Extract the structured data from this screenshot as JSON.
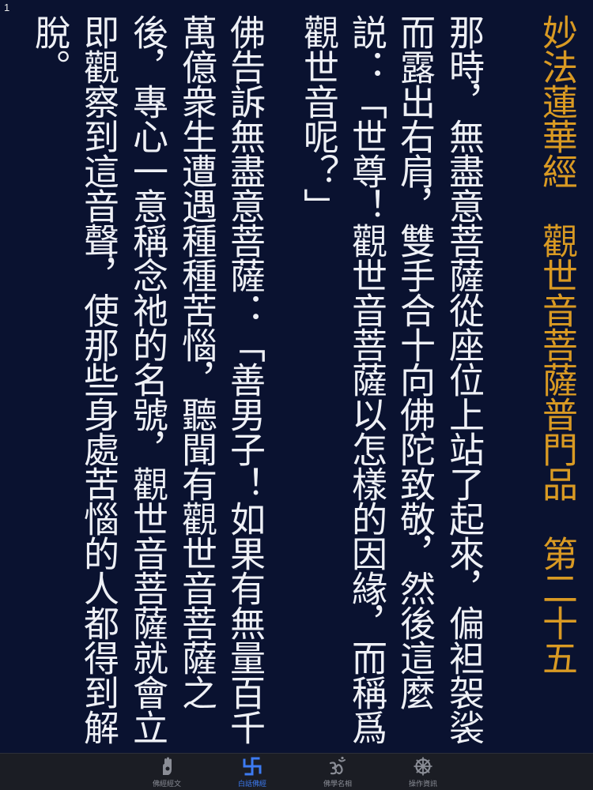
{
  "page_number": "1",
  "title_column": "妙法蓮華經　觀世音菩薩普門品　第二十五",
  "text_columns": [
    "那時，無盡意菩薩從座位上站了起來，偏袒袈裟",
    "而露出右肩，雙手合十向佛陀致敬，然後這麼",
    "説：「世尊！觀世音菩薩以怎樣的因緣，而稱爲",
    "觀世音呢？」",
    "佛告訴無盡意菩薩：「善男子！如果有無量百千",
    "萬億衆生遭遇種種苦惱，聽聞有觀世音菩薩之",
    "後，專心一意稱念祂的名號，觀世音菩薩就會立",
    "即觀察到這音聲，使那些身處苦惱的人都得到解",
    "脫。"
  ],
  "tabs": [
    {
      "label": "佛經經文",
      "icon": "hand-icon",
      "active": false
    },
    {
      "label": "白話佛經",
      "icon": "swastika-icon",
      "active": true
    },
    {
      "label": "佛學名相",
      "icon": "om-icon",
      "active": false
    },
    {
      "label": "操作資訊",
      "icon": "dharma-wheel-icon",
      "active": false
    }
  ],
  "colors": {
    "background": "#0a1230",
    "title_gold": "#d99a23",
    "text": "#eef0f5",
    "tab_active": "#3d7bf2",
    "tab_inactive": "#8a8d96",
    "tabbar_background": "#1b1d24"
  }
}
